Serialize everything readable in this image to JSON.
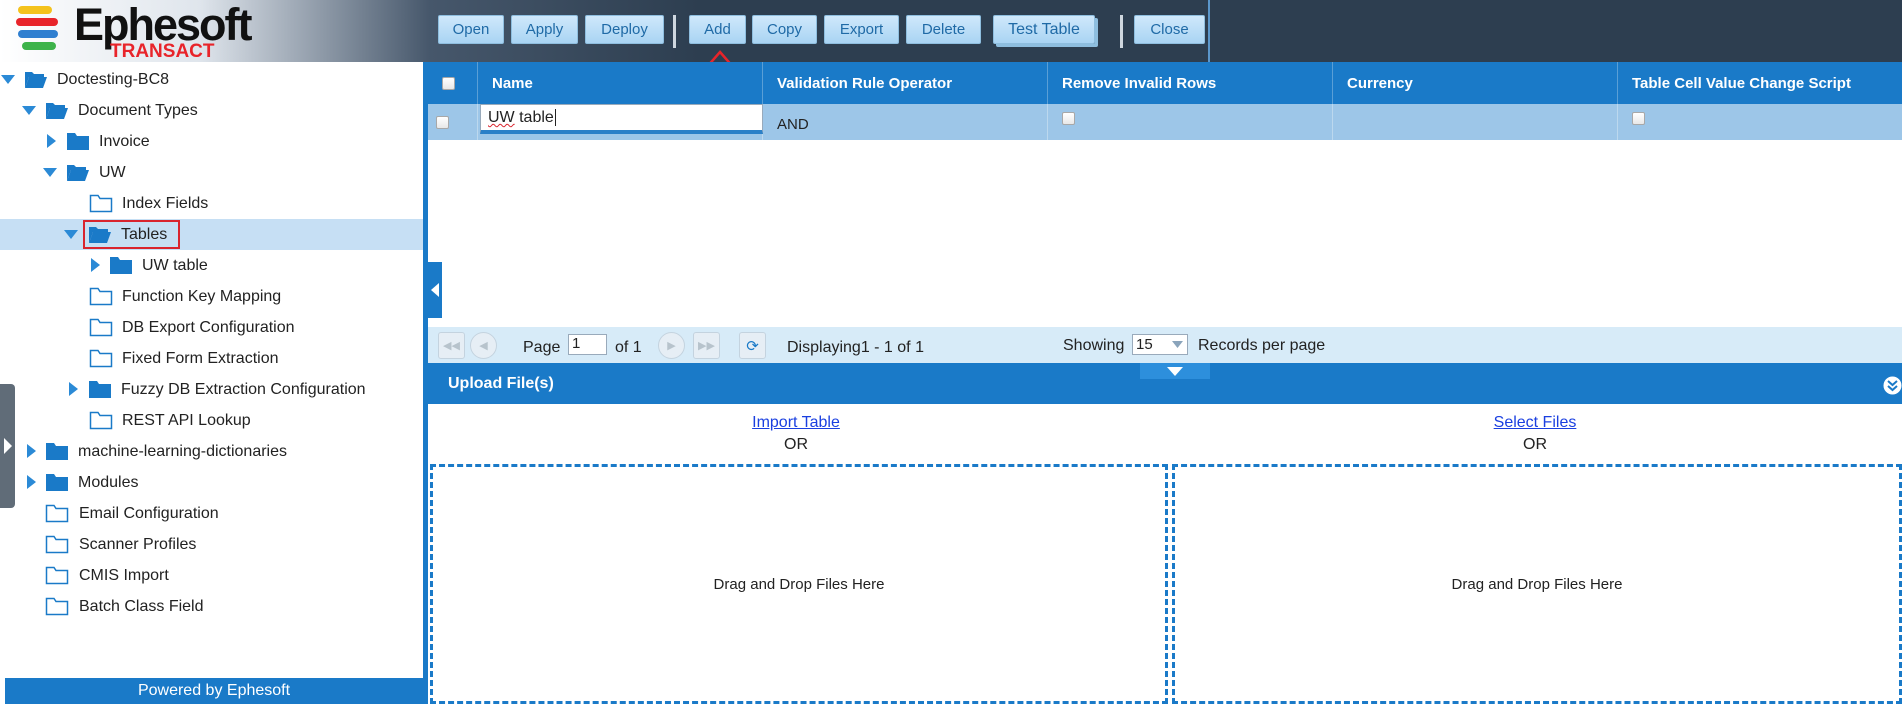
{
  "brand": {
    "name": "Ephesoft",
    "product": "TRANSACT",
    "powered_by": "Powered by Ephesoft"
  },
  "toolbar": {
    "open": "Open",
    "apply": "Apply",
    "deploy": "Deploy",
    "add": "Add",
    "copy": "Copy",
    "export": "Export",
    "delete": "Delete",
    "test_table": "Test Table",
    "close": "Close"
  },
  "tree": {
    "root": "Doctesting-BC8",
    "document_types": "Document Types",
    "invoice": "Invoice",
    "uw": "UW",
    "index_fields": "Index Fields",
    "tables": "Tables",
    "uw_table": "UW table",
    "function_key_mapping": "Function Key Mapping",
    "db_export_configuration": "DB Export Configuration",
    "fixed_form_extraction": "Fixed Form Extraction",
    "fuzzy_db_extraction_configuration": "Fuzzy DB Extraction Configuration",
    "rest_api_lookup": "REST API Lookup",
    "machine_learning_dictionaries": "machine-learning-dictionaries",
    "modules": "Modules",
    "email_configuration": "Email Configuration",
    "scanner_profiles": "Scanner Profiles",
    "cmis_import": "CMIS Import",
    "batch_class_field": "Batch Class Field"
  },
  "grid": {
    "columns": [
      "Name",
      "Validation Rule Operator",
      "Remove Invalid Rows",
      "Currency",
      "Table Cell Value Change Script"
    ],
    "row": {
      "name_part1": "UW",
      "name_part2": " table",
      "validation_rule_operator": "AND",
      "currency": ""
    }
  },
  "pager": {
    "page_label": "Page",
    "page_value": "1",
    "of_label": "of 1",
    "displaying": "Displaying1 - 1 of 1",
    "showing_label": "Showing",
    "per_page_value": "15",
    "records_label": "Records per page"
  },
  "upload": {
    "title": "Upload File(s)",
    "import_table": "Import Table",
    "select_files": "Select Files",
    "or": "OR",
    "drop_text": "Drag and Drop Files Here"
  },
  "colors": {
    "accent": "#1a7ac8",
    "selected_row": "#c6dff4",
    "highlight_box": "#d9242e"
  }
}
